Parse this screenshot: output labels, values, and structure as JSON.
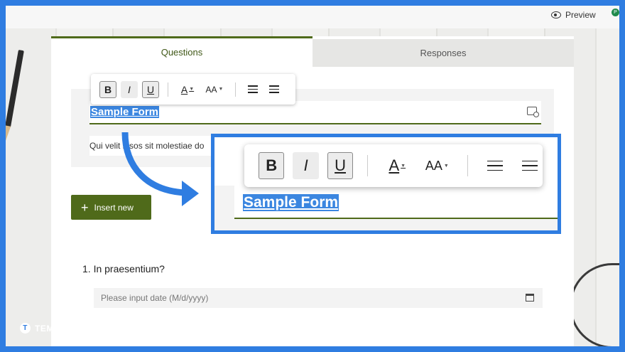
{
  "topbar": {
    "preview_label": "Preview",
    "avatar_letter": "P"
  },
  "tabs": [
    {
      "label": "Questions"
    },
    {
      "label": "Responses"
    }
  ],
  "form": {
    "title": "Sample Form",
    "description": "Qui velit ipsos sit molestiae do",
    "insert_label": "Insert new"
  },
  "toolbar": {
    "bold": "B",
    "italic": "I",
    "underline": "U",
    "font_color": "A",
    "font_size": "AA"
  },
  "question": {
    "label": "1. In praesentium?",
    "placeholder": "Please input date (M/d/yyyy)"
  },
  "zoom": {
    "title": "Sample Form"
  },
  "watermark": {
    "brand": "TEMPLATE.NET",
    "logo": "T"
  },
  "colors": {
    "accent": "#4f6a1a",
    "highlight": "#2f7de1"
  }
}
